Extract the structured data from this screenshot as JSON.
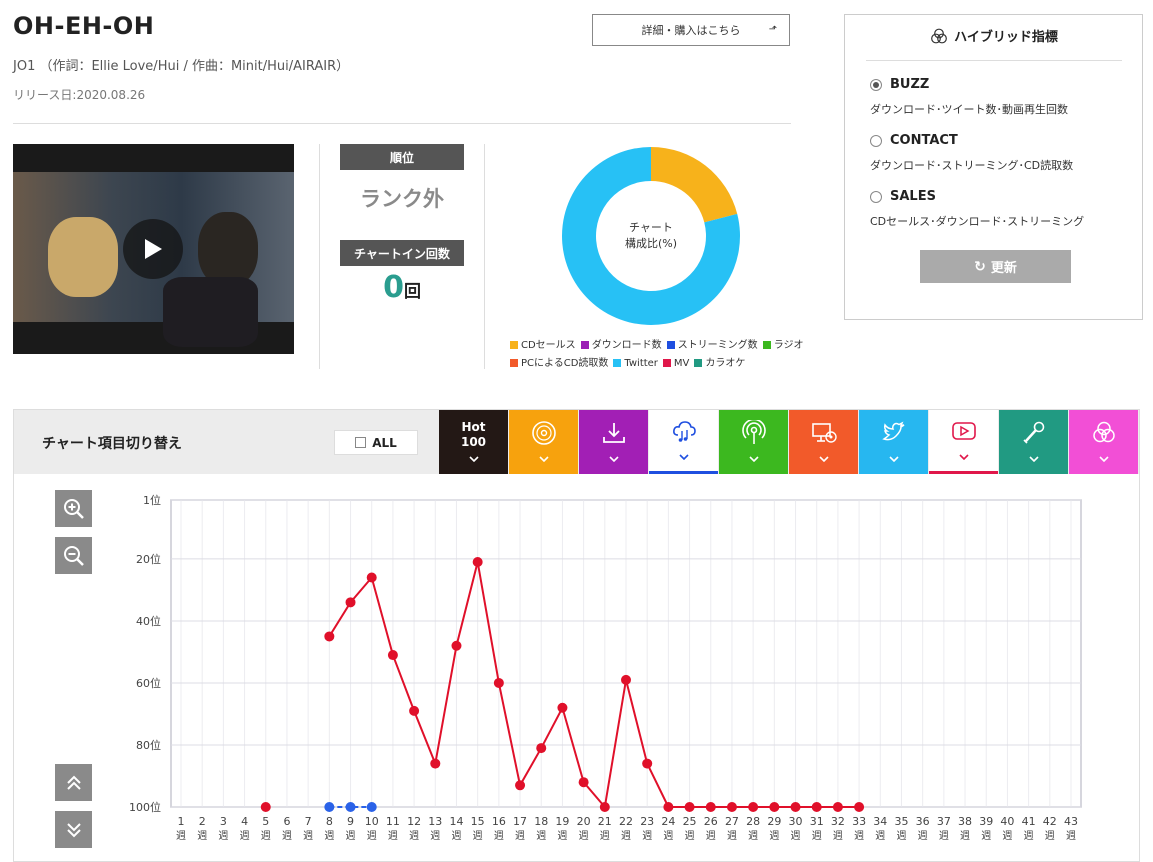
{
  "song": {
    "title": "OH-EH-OH",
    "credits": "JO1 （作詞：Ellie Love/Hui / 作曲：Minit/Hui/AIRAIR）",
    "release": "リリース日:2020.08.26"
  },
  "detail_button": {
    "label": "詳細・購入はこちら",
    "icon": "external-arrow-icon"
  },
  "video": {
    "icon": "play-icon"
  },
  "rank": {
    "label": "順位",
    "value": "ランク外"
  },
  "chartin": {
    "label": "チャートイン回数",
    "value": "0",
    "unit": "回"
  },
  "donut": {
    "center_label_1": "チャート",
    "center_label_2": "構成比(%)",
    "slices": [
      {
        "name": "CDセールス",
        "value": 21,
        "color": "#f7b21b"
      },
      {
        "name": "Twitter",
        "value": 79,
        "color": "#27c1f5"
      }
    ],
    "legend": [
      {
        "name": "CDセールス",
        "color": "#f7b21b"
      },
      {
        "name": "ダウンロード数",
        "color": "#9b1fb5"
      },
      {
        "name": "ストリーミング数",
        "color": "#1f4fe0"
      },
      {
        "name": "ラジオ",
        "color": "#3cb81f"
      },
      {
        "name": "PCによるCD読取数",
        "color": "#f25a2a"
      },
      {
        "name": "Twitter",
        "color": "#27c1f5"
      },
      {
        "name": "MV",
        "color": "#e0174a"
      },
      {
        "name": "カラオケ",
        "color": "#219a82"
      }
    ]
  },
  "hybrid": {
    "title": "ハイブリッド指標",
    "icon": "venn-icon",
    "options": [
      {
        "label": "BUZZ",
        "desc": "ダウンロード･ツイート数･動画再生回数",
        "selected": true
      },
      {
        "label": "CONTACT",
        "desc": "ダウンロード･ストリーミング･CD読取数",
        "selected": false
      },
      {
        "label": "SALES",
        "desc": "CDセールス･ダウンロード･ストリーミング",
        "selected": false
      }
    ],
    "update_label": "更新",
    "update_icon": "refresh-icon"
  },
  "switcher": {
    "title": "チャート項目切り替え",
    "all_label": "ALL",
    "tabs": [
      {
        "name": "hot100",
        "label": "Hot\n100",
        "icon": "",
        "bg": "#231815",
        "style": "solid"
      },
      {
        "name": "cd-sales",
        "label": "",
        "icon": "cd-icon",
        "bg": "#f7a20d",
        "style": "solid"
      },
      {
        "name": "download",
        "label": "",
        "icon": "download-icon",
        "bg": "#a21fb5",
        "style": "solid"
      },
      {
        "name": "streaming",
        "label": "",
        "icon": "cloud-music-icon",
        "bg": "#1f4fe0",
        "style": "white"
      },
      {
        "name": "radio",
        "label": "",
        "icon": "radio-icon",
        "bg": "#3cb81f",
        "style": "solid"
      },
      {
        "name": "pc-read",
        "label": "",
        "icon": "pc-cd-icon",
        "bg": "#f25a2a",
        "style": "solid"
      },
      {
        "name": "twitter",
        "label": "",
        "icon": "twitter-icon",
        "bg": "#27b7f0",
        "style": "solid"
      },
      {
        "name": "mv",
        "label": "",
        "icon": "youtube-icon",
        "bg": "#e0174a",
        "style": "white"
      },
      {
        "name": "karaoke",
        "label": "",
        "icon": "mic-icon",
        "bg": "#219a82",
        "style": "solid"
      },
      {
        "name": "hybrid",
        "label": "",
        "icon": "venn-icon",
        "bg": "#f24fd6",
        "style": "solid"
      }
    ]
  },
  "tools": {
    "zoom_in": "zoom-in-icon",
    "zoom_out": "zoom-out-icon",
    "scroll_up": "double-chevron-up-icon",
    "scroll_down": "double-chevron-down-icon"
  },
  "chart_data": {
    "type": "line",
    "x": [
      "1",
      "2",
      "3",
      "4",
      "5",
      "6",
      "7",
      "8",
      "9",
      "10",
      "11",
      "12",
      "13",
      "14",
      "15",
      "16",
      "17",
      "18",
      "19",
      "20",
      "21",
      "22",
      "23",
      "24",
      "25",
      "26",
      "27",
      "28",
      "29",
      "30",
      "31",
      "32",
      "33",
      "34",
      "35",
      "36",
      "37",
      "38",
      "39",
      "40",
      "41",
      "42",
      "43"
    ],
    "x_suffix": "週",
    "y_ticks": [
      "1位",
      "20位",
      "40位",
      "60位",
      "80位",
      "100位"
    ],
    "y_tick_values": [
      1,
      20,
      40,
      60,
      80,
      100
    ],
    "ylim": [
      1,
      100
    ],
    "y_inverted": true,
    "grid": true,
    "series": [
      {
        "color": "#e0102a",
        "points": [
          [
            5,
            100
          ],
          [
            8,
            45
          ],
          [
            9,
            34
          ],
          [
            10,
            26
          ],
          [
            11,
            51
          ],
          [
            12,
            69
          ],
          [
            13,
            86
          ],
          [
            14,
            48
          ],
          [
            15,
            21
          ],
          [
            16,
            60
          ],
          [
            17,
            93
          ],
          [
            18,
            81
          ],
          [
            19,
            68
          ],
          [
            20,
            92
          ],
          [
            21,
            100
          ],
          [
            22,
            59
          ],
          [
            23,
            86
          ],
          [
            24,
            100
          ],
          [
            25,
            100
          ],
          [
            26,
            100
          ],
          [
            27,
            100
          ],
          [
            28,
            100
          ],
          [
            29,
            100
          ],
          [
            30,
            100
          ],
          [
            31,
            100
          ],
          [
            32,
            100
          ],
          [
            33,
            100
          ]
        ],
        "segments": [
          [
            8,
            9,
            10,
            11,
            12,
            13,
            14,
            15,
            16,
            17,
            18,
            19,
            20,
            21,
            22,
            23,
            24
          ],
          [
            24,
            25,
            26,
            27,
            28,
            29,
            30,
            31,
            32,
            33
          ]
        ]
      },
      {
        "color": "#2a62e8",
        "points": [
          [
            8,
            100
          ],
          [
            9,
            100
          ],
          [
            10,
            100
          ]
        ],
        "segments": [
          [
            8,
            9,
            10
          ]
        ]
      }
    ]
  }
}
